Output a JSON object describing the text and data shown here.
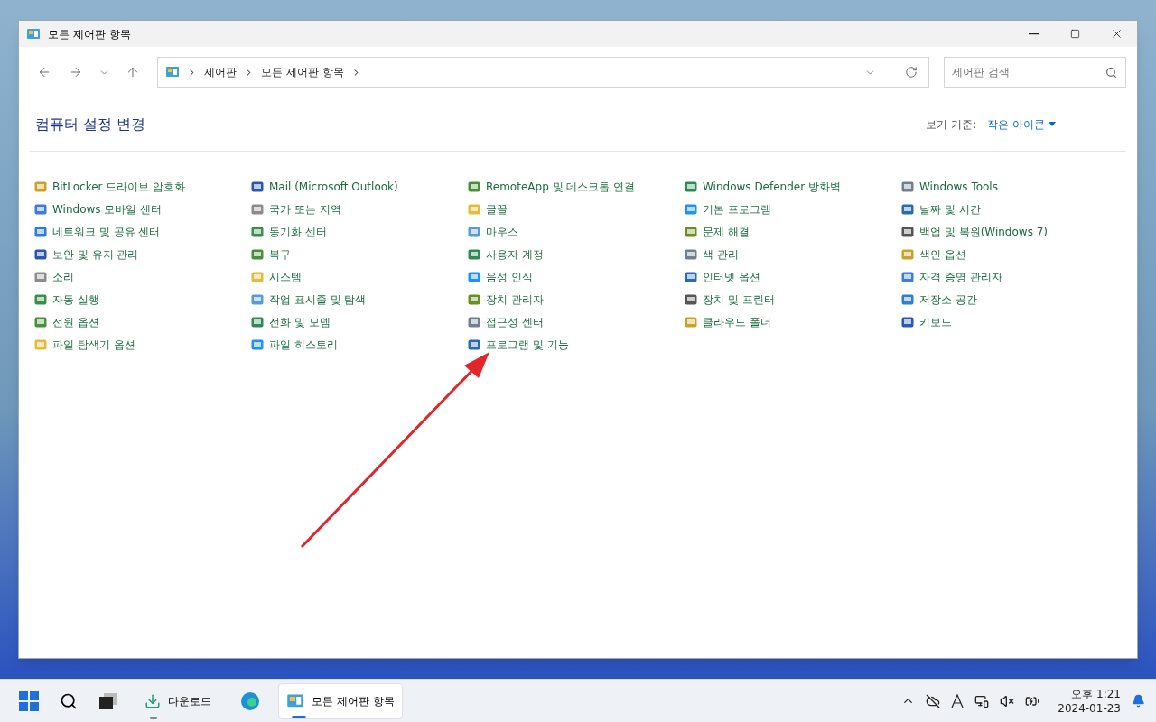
{
  "window": {
    "title": "모든 제어판 항목"
  },
  "address": {
    "crumbs": [
      "제어판",
      "모든 제어판 항목"
    ]
  },
  "search": {
    "placeholder": "제어판 검색"
  },
  "heading": "컴퓨터 설정 변경",
  "view": {
    "label": "보기 기준:",
    "value": "작은 아이콘"
  },
  "columns": [
    [
      "BitLocker 드라이브 암호화",
      "Windows 모바일 센터",
      "네트워크 및 공유 센터",
      "보안 및 유지 관리",
      "소리",
      "자동 실행",
      "전원 옵션",
      "파일 탐색기 옵션"
    ],
    [
      "Mail (Microsoft Outlook)",
      "국가 또는 지역",
      "동기화 센터",
      "복구",
      "시스템",
      "작업 표시줄 및 탐색",
      "전화 및 모뎀",
      "파일 히스토리"
    ],
    [
      "RemoteApp 및 데스크톱 연결",
      "글꼴",
      "마우스",
      "사용자 계정",
      "음성 인식",
      "장치 관리자",
      "접근성 센터",
      "프로그램 및 기능"
    ],
    [
      "Windows Defender 방화벽",
      "기본 프로그램",
      "문제 해결",
      "색 관리",
      "인터넷 옵션",
      "장치 및 프린터",
      "클라우드 폴더"
    ],
    [
      "Windows Tools",
      "날짜 및 시간",
      "백업 및 복원(Windows 7)",
      "색인 옵션",
      "자격 증명 관리자",
      "저장소 공간",
      "키보드"
    ]
  ],
  "taskbar": {
    "apps": [
      {
        "label": "다운로드",
        "selected": false
      },
      {
        "label": "모든 제어판 항목",
        "selected": true
      }
    ],
    "time": "오후 1:21",
    "date": "2024-01-23"
  }
}
